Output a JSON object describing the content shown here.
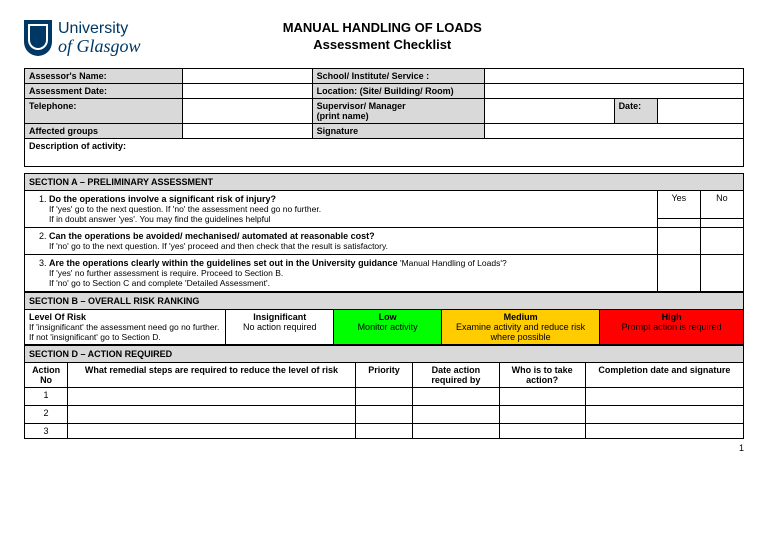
{
  "logo": {
    "line1": "University",
    "line2": "of Glasgow"
  },
  "title": {
    "line1": "MANUAL HANDLING OF LOADS",
    "line2": "Assessment Checklist"
  },
  "info": {
    "assessor": "Assessor's Name:",
    "school": "School/ Institute/ Service :",
    "date": "Assessment Date:",
    "location": "Location: (Site/ Building/ Room)",
    "tel": "Telephone:",
    "supervisor": "Supervisor/ Manager\n(print name)",
    "date2": "Date:",
    "groups": "Affected groups",
    "signature": "Signature",
    "desc": "Description of activity:"
  },
  "secA": {
    "header": "SECTION A – PRELIMINARY  ASSESSMENT",
    "yes": "Yes",
    "no": "No",
    "q1": "Do the operations involve a significant risk of injury?",
    "q1sub": "If 'yes' go to the next question. If 'no' the assessment need go no further.\nIf in doubt answer 'yes'. You may find the guidelines helpful",
    "q2": "Can the operations be avoided/ mechanised/ automated at reasonable cost?",
    "q2sub": "If 'no' go to the next question. If 'yes' proceed and then check that the result is satisfactory.",
    "q3a": "Are the operations clearly within the guidelines set out in the University guidance",
    "q3b": " 'Manual Handling of Loads'?",
    "q3sub": "If 'yes' no further assessment is require. Proceed to Section B.\nIf 'no' go to Section C and complete 'Detailed Assessment'."
  },
  "secB": {
    "header": "SECTION B – OVERALL RISK RANKING",
    "level_title": "Level Of Risk",
    "level_sub": "If 'insignificant' the assessment need go no further.\nIf not 'insignificant' go to Section D.",
    "insig_t": "Insignificant",
    "insig_s": "No action required",
    "low_t": "Low",
    "low_s": "Monitor activity",
    "med_t": "Medium",
    "med_s": "Examine activity and reduce risk where possible",
    "high_t": "High",
    "high_s": "Prompt action is required"
  },
  "secD": {
    "header": "SECTION D – ACTION  REQUIRED",
    "col_action": "Action No",
    "col_steps": "What remedial steps are required to reduce the level of risk",
    "col_priority": "Priority",
    "col_due": "Date action required by",
    "col_who": "Who is to take action?",
    "col_done": "Completion date and signature",
    "r1": "1",
    "r2": "2",
    "r3": "3"
  },
  "page": "1"
}
